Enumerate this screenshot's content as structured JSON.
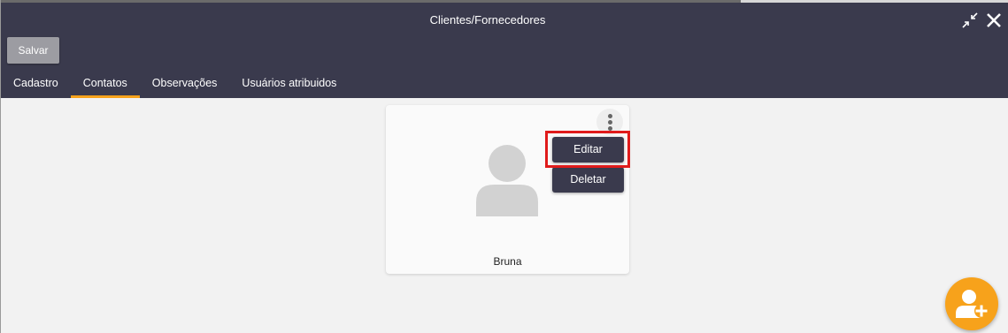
{
  "window": {
    "title": "Clientes/Fornecedores",
    "collapse_icon": "collapse-arrows-icon",
    "close_icon": "close-icon"
  },
  "toolbar": {
    "save_label": "Salvar"
  },
  "tabs": [
    {
      "label": "Cadastro",
      "active": false
    },
    {
      "label": "Contatos",
      "active": true
    },
    {
      "label": "Observações",
      "active": false
    },
    {
      "label": "Usuários atribuidos",
      "active": false
    }
  ],
  "contact_card": {
    "name": "Bruna",
    "avatar_icon": "person-placeholder-icon",
    "more_icon": "more-vertical-icon",
    "menu": {
      "edit_label": "Editar",
      "delete_label": "Deletar"
    }
  },
  "fab": {
    "icon": "add-user-icon"
  },
  "colors": {
    "header_bg": "#3a3a4d",
    "accent": "#f7a21b",
    "highlight": "#e01b1b",
    "page_bg": "#f2f2f2"
  }
}
